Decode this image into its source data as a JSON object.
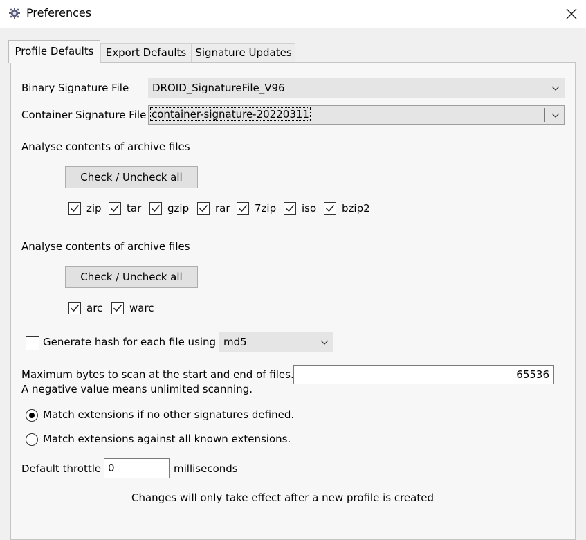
{
  "window": {
    "title": "Preferences",
    "app_icon": "gear-icon",
    "close_icon": "close-icon"
  },
  "tabs": [
    {
      "label": "Profile Defaults",
      "active": true
    },
    {
      "label": "Export Defaults",
      "active": false
    },
    {
      "label": "Signature Updates",
      "active": false
    }
  ],
  "binary_signature": {
    "label": "Binary Signature File",
    "value": "DROID_SignatureFile_V96"
  },
  "container_signature": {
    "label": "Container Signature File",
    "value": "container-signature-20220311"
  },
  "archive_section_1": {
    "heading": "Analyse contents of archive files",
    "button": "Check / Uncheck all",
    "options": [
      {
        "label": "zip",
        "checked": true
      },
      {
        "label": "tar",
        "checked": true
      },
      {
        "label": "gzip",
        "checked": true
      },
      {
        "label": "rar",
        "checked": true
      },
      {
        "label": "7zip",
        "checked": true
      },
      {
        "label": "iso",
        "checked": true
      },
      {
        "label": "bzip2",
        "checked": true
      }
    ]
  },
  "archive_section_2": {
    "heading": "Analyse contents of archive files",
    "button": "Check / Uncheck all",
    "options": [
      {
        "label": "arc",
        "checked": true
      },
      {
        "label": "warc",
        "checked": true
      }
    ]
  },
  "hash": {
    "label": "Generate hash for each file using",
    "checked": false,
    "algorithm": "md5"
  },
  "max_bytes": {
    "label_line1": "Maximum bytes to scan at the start and end of files.",
    "label_line2": "A negative value means unlimited scanning.",
    "value": "65536"
  },
  "extensions": [
    {
      "label": "Match extensions if no other signatures defined.",
      "selected": true
    },
    {
      "label": "Match extensions against all known extensions.",
      "selected": false
    }
  ],
  "throttle": {
    "label": "Default throttle",
    "value": "0",
    "unit": "milliseconds"
  },
  "note": "Changes will only take effect after a new profile is created"
}
